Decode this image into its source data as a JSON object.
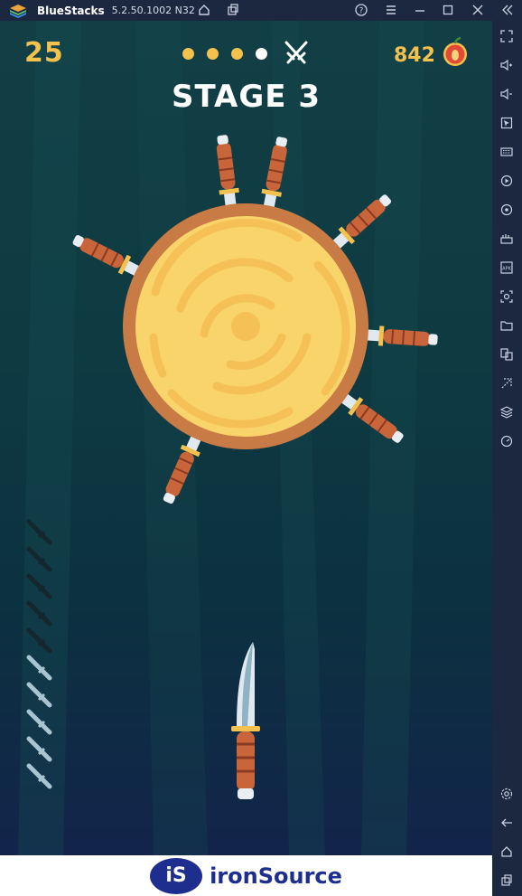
{
  "window": {
    "app_name": "BlueStacks",
    "version": "5.2.50.1002 N32"
  },
  "titlebar_icons": [
    "home-icon",
    "multi-instance-icon",
    "help-icon",
    "menu-icon",
    "minimize-icon",
    "maximize-icon",
    "close-icon",
    "collapse-sidebar-icon"
  ],
  "sidebar_icons": [
    "fullscreen-icon",
    "volume-up-icon",
    "volume-down-icon",
    "pointer-icon",
    "keyboard-icon",
    "record-icon",
    "rotate-icon",
    "macro-icon",
    "apk-icon",
    "screenshot-icon",
    "folder-icon",
    "multi-window-icon",
    "eco-mode-icon",
    "layers-icon",
    "performance-icon",
    "settings-icon",
    "back-icon",
    "home-icon",
    "recents-icon"
  ],
  "game": {
    "score": "25",
    "stage_title": "STAGE 3",
    "apples": "842",
    "stage_progress": {
      "total": 4,
      "current": 4,
      "boss_next": true
    },
    "target_knives_stuck": 7,
    "knives_remaining": {
      "total": 10,
      "used": 5,
      "remaining": 5
    }
  },
  "ad": {
    "badge": "iS",
    "brand": "ironSource"
  },
  "colors": {
    "accent_yellow": "#f2c14e",
    "wood_light": "#f8d46a",
    "wood_rim": "#c97b45",
    "handle": "#c8653a",
    "blade": "#dfe9ef",
    "window_chrome": "#1c2740",
    "ad_brand": "#1e2e8e"
  }
}
